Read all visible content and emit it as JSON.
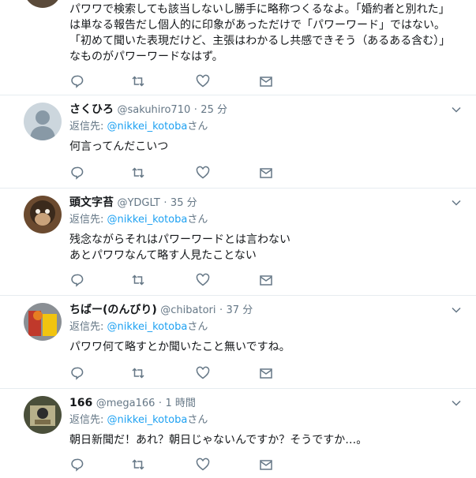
{
  "tweet0": {
    "lines": [
      "パワワで検索しても該当しないし勝手に略称つくるなよ。「婚約者と別れた」",
      "は単なる報告だし個人的に印象があっただけで「パワーワード」ではない。",
      "「初めて聞いた表現だけど、主張はわかるし共感できそう（あるある含む）」",
      "なものがパワーワードなはず。"
    ]
  },
  "tweets": [
    {
      "name": "さくひろ",
      "handle": "@sakuhiro710",
      "dot": "·",
      "time": "25 分",
      "reply_prefix": "返信先: ",
      "reply_user": "@nikkei_kotoba",
      "reply_suffix": "さん",
      "lines": [
        "何言ってんだこいつ"
      ]
    },
    {
      "name": "頭文字苔",
      "handle": "@YDGLT",
      "dot": "·",
      "time": "35 分",
      "reply_prefix": "返信先: ",
      "reply_user": "@nikkei_kotoba",
      "reply_suffix": "さん",
      "lines": [
        "残念ながらそれはパワーワードとは言わない",
        "あとパワワなんて略す人見たことない"
      ]
    },
    {
      "name": "ちばー(のんびり)",
      "handle": "@chibatori",
      "dot": "·",
      "time": "37 分",
      "reply_prefix": "返信先: ",
      "reply_user": "@nikkei_kotoba",
      "reply_suffix": "さん",
      "lines": [
        "パワワ何て略すとか聞いたこと無いですね。"
      ]
    },
    {
      "name": "166",
      "handle": "@mega166",
      "dot": "·",
      "time": "1 時間",
      "reply_prefix": "返信先: ",
      "reply_user": "@nikkei_kotoba",
      "reply_suffix": "さん",
      "lines": [
        "朝日新聞だ！あれ？朝日じゃないんですか？そうですか…。"
      ]
    }
  ],
  "colors": {
    "link": "#1da1f2",
    "secondary": "#657786",
    "text": "#14171a",
    "divider": "#e6ecf0"
  },
  "icons": [
    "reply-icon",
    "retweet-icon",
    "like-icon",
    "message-icon",
    "chevron-down-icon"
  ]
}
